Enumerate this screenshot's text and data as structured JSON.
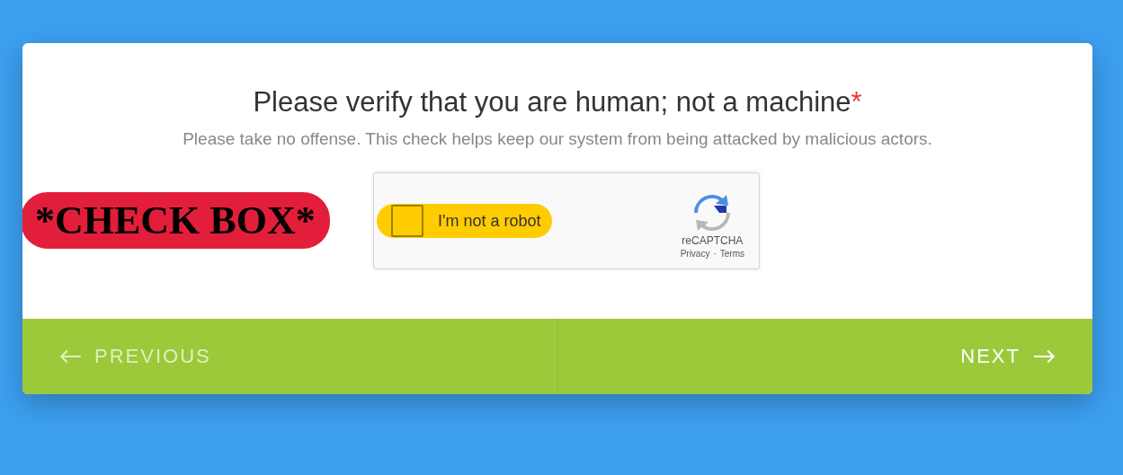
{
  "title": "Please verify that you are human; not a machine",
  "required_mark": "*",
  "subtitle": "Please take no offense. This check helps keep our system from being attacked by malicious actors.",
  "captcha": {
    "label": "I'm not a robot",
    "checked": false,
    "brand": "reCAPTCHA",
    "links": [
      "Privacy",
      "Terms"
    ],
    "separator": "·"
  },
  "annotation": {
    "label": "*CHECK BOX*"
  },
  "buttons": [
    {
      "label": "PREVIOUS",
      "kind": "back",
      "disabled": true
    },
    {
      "label": "NEXT",
      "kind": "forward",
      "disabled": false
    }
  ]
}
